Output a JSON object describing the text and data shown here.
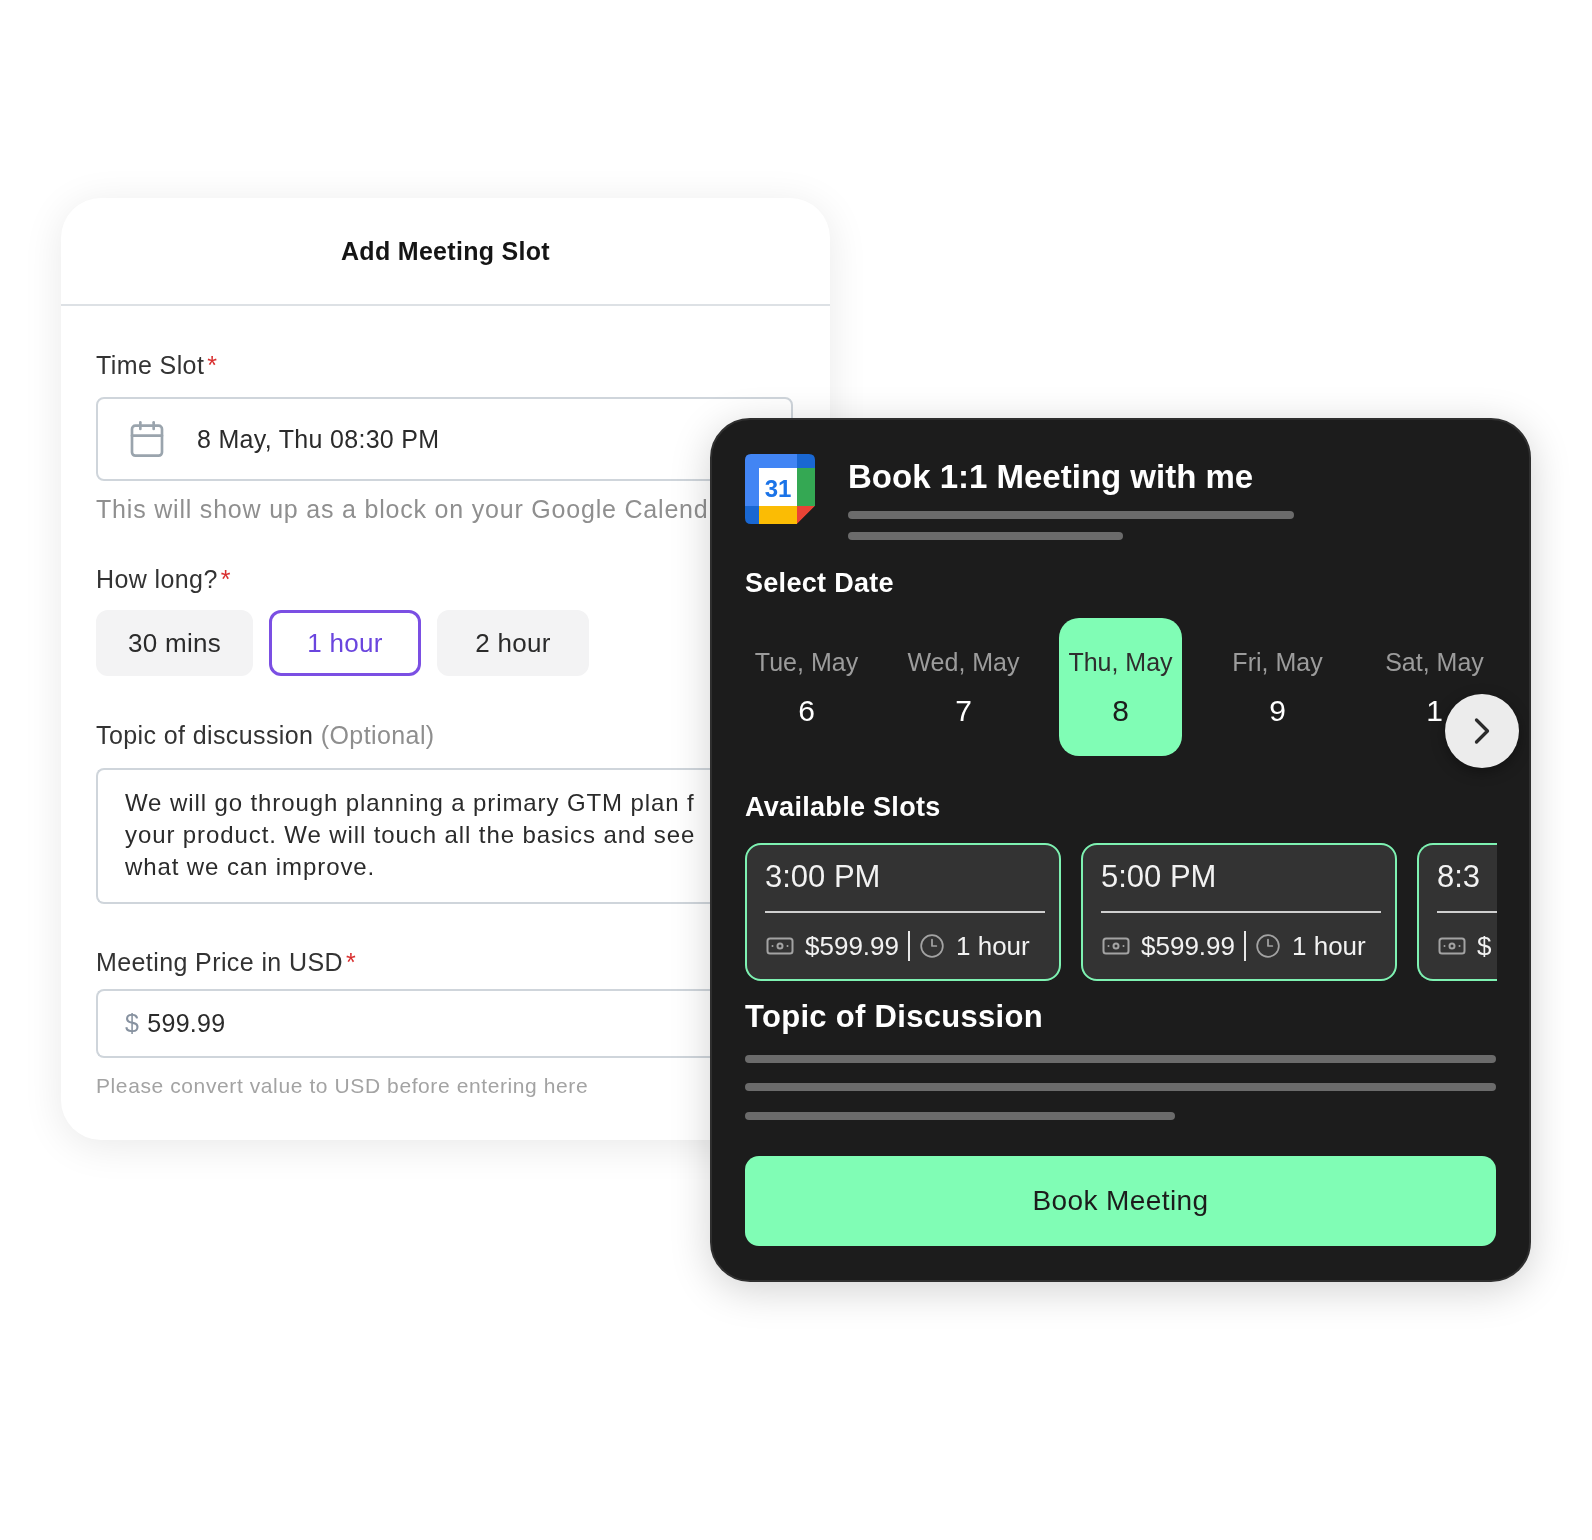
{
  "form_card": {
    "title": "Add Meeting Slot",
    "time_slot": {
      "label": "Time Slot",
      "required_mark": "*",
      "value": "8 May, Thu 08:30 PM",
      "hint": "This will show up as a block on your Google Calend"
    },
    "duration": {
      "label": "How long?",
      "required_mark": "*",
      "options": [
        {
          "label": "30 mins",
          "selected": false
        },
        {
          "label": "1 hour",
          "selected": true
        },
        {
          "label": "2 hour",
          "selected": false
        }
      ]
    },
    "topic": {
      "label": "Topic of discussion",
      "note": "(Optional)",
      "value_lines": [
        "We will go through planning a primary GTM plan f",
        "your product. We will touch all the basics and see",
        "what we can improve."
      ]
    },
    "price": {
      "label": "Meeting Price in USD",
      "required_mark": "*",
      "currency": "$",
      "value": "599.99",
      "hint": "Please convert value to USD before entering here"
    }
  },
  "booking_card": {
    "logo_text": "31",
    "title": "Book 1:1 Meeting with me",
    "select_date": {
      "heading": "Select Date",
      "dates": [
        {
          "weekday": "Tue, May",
          "day": "6",
          "selected": false
        },
        {
          "weekday": "Wed, May",
          "day": "7",
          "selected": false
        },
        {
          "weekday": "Thu, May",
          "day": "8",
          "selected": true
        },
        {
          "weekday": "Fri, May",
          "day": "9",
          "selected": false
        },
        {
          "weekday": "Sat, May",
          "day": "1",
          "selected": false
        }
      ]
    },
    "available_slots": {
      "heading": "Available Slots",
      "slots": [
        {
          "kind": "full",
          "time": "3:00 PM",
          "price": "$599.99",
          "duration": "1 hour"
        },
        {
          "kind": "full",
          "time": "5:00 PM",
          "price": "$599.99",
          "duration": "1 hour"
        },
        {
          "kind": "partial",
          "time": "8:3",
          "price": "$"
        }
      ]
    },
    "topic_heading": "Topic of Discussion",
    "button": "Book Meeting"
  }
}
